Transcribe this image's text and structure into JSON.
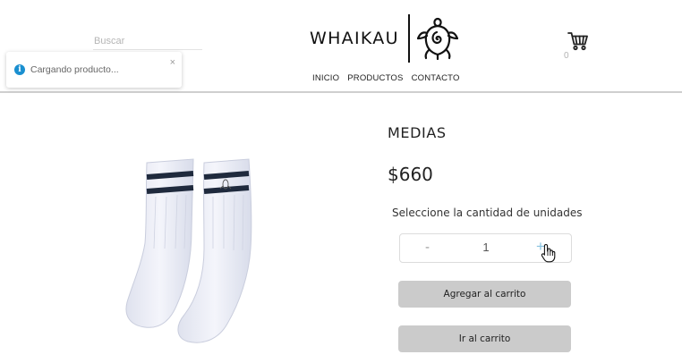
{
  "search": {
    "placeholder": "Buscar"
  },
  "brand": {
    "name": "WHAIKAU",
    "logo_icon": "turtle-icon"
  },
  "nav": {
    "items": [
      {
        "label": "INICIO"
      },
      {
        "label": "PRODUCTOS"
      },
      {
        "label": "CONTACTO"
      }
    ]
  },
  "cart": {
    "icon": "cart-icon",
    "count": "0"
  },
  "toast": {
    "icon": "info-icon",
    "message": "Cargando producto...",
    "close_label": "×",
    "accent_color": "#1a8fd0"
  },
  "product": {
    "title": "MEDIAS",
    "price": "$660",
    "image": "socks-image",
    "quantity_label": "Seleccione la cantidad de unidades",
    "quantity": {
      "decrement_label": "-",
      "value": "1",
      "increment_label": "+"
    },
    "add_to_cart_label": "Agregar al carrito",
    "go_to_cart_label": "Ir al carrito"
  },
  "colors": {
    "button_bg": "#cbcbcb",
    "stripe": "#1f2a3d",
    "sock": "#eef0f8"
  }
}
